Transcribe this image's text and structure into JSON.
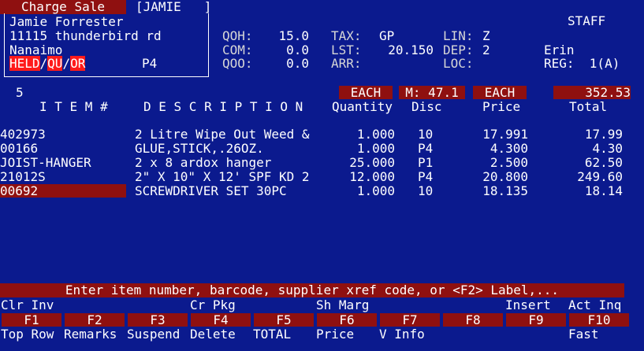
{
  "header": {
    "mode_title": "Charge Sale",
    "account_code": "[JAMIE   ]",
    "role": "STAFF",
    "customer_name": "Jamie Forrester",
    "address": "11115 thunderbird rd",
    "city": "Nanaimo",
    "held": "HELD",
    "slash": "/",
    "qu": "QU",
    "slash2": "/",
    "or": "OR",
    "price_level": "P4",
    "stats": {
      "qoh_label": "QOH:",
      "qoh_value": "15.0",
      "com_label": "COM:",
      "com_value": "0.0",
      "qoo_label": "QOO:",
      "qoo_value": "0.0",
      "tax_label": "TAX:",
      "tax_value": "GP",
      "lst_label": "LST:",
      "lst_value": "20.150",
      "arr_label": "ARR:",
      "lin_label": "LIN:",
      "lin_value": "Z",
      "dep_label": "DEP:",
      "dep_value": "2",
      "loc_label": "LOC:"
    },
    "clerk": "Erin",
    "register": "REG:  1(A)"
  },
  "columns": {
    "line_number": "5",
    "unit1": "EACH",
    "margin": "M: 47.1",
    "unit2": "EACH",
    "total_sum": "352.53",
    "item": "I T E M #",
    "description": "D E S C R I P T I O N",
    "quantity": "Quantity",
    "disc": "Disc",
    "price": "Price",
    "total": "Total"
  },
  "rows": [
    {
      "item": "402973",
      "description": "2 Litre Wipe Out Weed &",
      "quantity": "1.000",
      "disc": "10",
      "price": "17.991",
      "total": "17.99"
    },
    {
      "item": "00166",
      "description": "GLUE,STICK,.26OZ.",
      "quantity": "1.000",
      "disc": "P4",
      "price": "4.300",
      "total": "4.30"
    },
    {
      "item": "JOIST-HANGER",
      "description": "2 x 8 ardox hanger",
      "quantity": "25.000",
      "disc": "P1",
      "price": "2.500",
      "total": "62.50"
    },
    {
      "item": "21012S",
      "description": "2\" X 10\" X 12' SPF KD 2",
      "quantity": "12.000",
      "disc": "P4",
      "price": "20.800",
      "total": "249.60"
    },
    {
      "item": "00692",
      "description": "SCREWDRIVER SET 30PC",
      "quantity": "1.000",
      "disc": "10",
      "price": "18.135",
      "total": "18.14"
    }
  ],
  "prompt": "Enter item number, barcode, supplier xref code, or <F2> Label,...",
  "fkeys_top": [
    "Clr Inv",
    "",
    "",
    "Cr Pkg",
    "",
    "Sh Marg",
    "",
    "",
    "Insert",
    "Act Inq"
  ],
  "fkeys": [
    "F1",
    "F2",
    "F3",
    "F4",
    "F5",
    "F6",
    "F7",
    "F8",
    "F9",
    "F10"
  ],
  "fkeys_bottom": [
    "Top Row",
    "Remarks",
    "Suspend",
    "Delete",
    "TOTAL",
    "Price",
    "V Info",
    "",
    "",
    "Fast"
  ]
}
